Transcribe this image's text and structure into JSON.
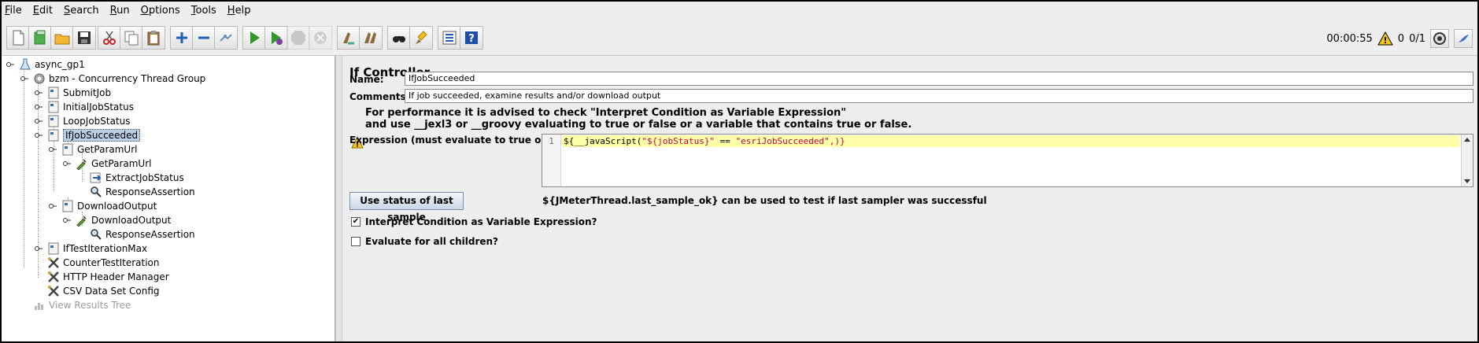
{
  "menu": [
    "File",
    "Edit",
    "Search",
    "Run",
    "Options",
    "Tools",
    "Help"
  ],
  "toolbar": {
    "buttons": [
      {
        "icon": "new-icon"
      },
      {
        "icon": "templates-icon"
      },
      {
        "icon": "open-icon"
      },
      {
        "icon": "save-icon"
      },
      {
        "icon": "cut-icon"
      },
      {
        "icon": "copy-icon"
      },
      {
        "icon": "paste-icon"
      },
      {
        "icon": "expand-icon"
      },
      {
        "icon": "collapse-icon"
      },
      {
        "icon": "toggle-icon"
      },
      {
        "icon": "start-icon"
      },
      {
        "icon": "start-no-pauses-icon"
      },
      {
        "icon": "stop-icon"
      },
      {
        "icon": "shutdown-icon"
      },
      {
        "icon": "clear-icon"
      },
      {
        "icon": "clear-all-icon"
      },
      {
        "icon": "search-icon"
      },
      {
        "icon": "reset-search-icon"
      },
      {
        "icon": "function-helper-icon"
      },
      {
        "icon": "help-icon"
      }
    ],
    "elapsed": "00:00:55",
    "warnings": "0",
    "threads": "0/1"
  },
  "tree": {
    "nodes": [
      {
        "label": "async_gp1"
      },
      {
        "label": "bzm - Concurrency Thread Group"
      },
      {
        "label": "SubmitJob"
      },
      {
        "label": "InitialJobStatus"
      },
      {
        "label": "LoopJobStatus"
      },
      {
        "label": "IfJobSucceeded"
      },
      {
        "label": "GetParamUrl"
      },
      {
        "label": "GetParamUrl"
      },
      {
        "label": "ExtractJobStatus"
      },
      {
        "label": "ResponseAssertion"
      },
      {
        "label": "DownloadOutput"
      },
      {
        "label": "DownloadOutput"
      },
      {
        "label": "ResponseAssertion"
      },
      {
        "label": "IfTestIterationMax"
      },
      {
        "label": "CounterTestIteration"
      },
      {
        "label": "HTTP Header Manager"
      },
      {
        "label": "CSV Data Set Config"
      },
      {
        "label": "View Results Tree"
      }
    ]
  },
  "panel": {
    "title": "If Controller",
    "name_label": "Name:",
    "name_value": "IfJobSucceeded",
    "comments_label": "Comments:",
    "comments_value": "If job succeeded, examine results and/or download output",
    "warning_line1": "For performance it is advised to check \"Interpret Condition as Variable Expression\"",
    "warning_line2": "and use __jexl3 or __groovy evaluating to true or false or a variable that contains true or false.",
    "expression_label": "Expression (must evaluate to true or false)",
    "line_number": "1",
    "code_prefix": "${",
    "code_func": "__javaScript(",
    "code_string1": "\"${jobStatus}\"",
    "code_op": " == ",
    "code_string2": "\"esriJobSucceeded\"",
    "code_suffix": ",)}",
    "use_last_sample_button": "Use status of last sample",
    "last_sample_info": "${JMeterThread.last_sample_ok} can be used to test if last sampler was successful",
    "interpret_label": "Interpret Condition as Variable Expression?",
    "interpret_checked": "✔",
    "evaluate_all_label": "Evaluate for all children?"
  }
}
